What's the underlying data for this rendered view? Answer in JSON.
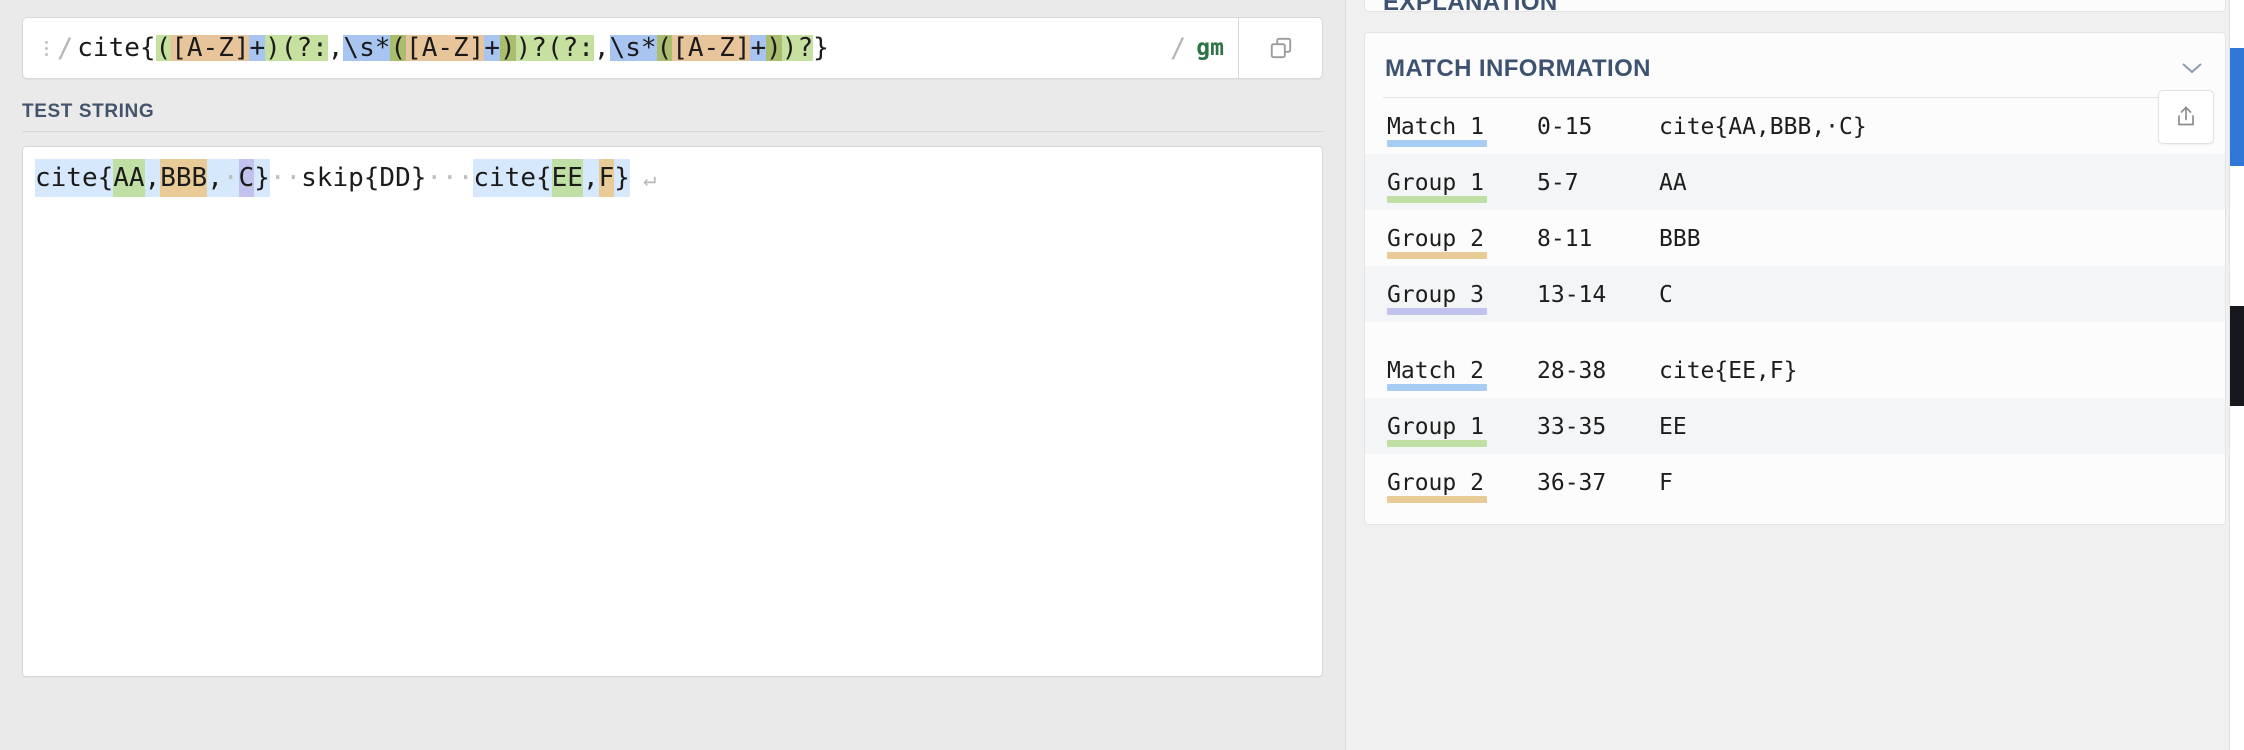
{
  "regex": {
    "delimiter": "/",
    "flags": "gm",
    "pattern_plain": "cite{([A-Z]+)(?:,\\s*([A-Z]+))?(?:,\\s*([A-Z]+))?}",
    "tokens": [
      {
        "t": "cite{",
        "bg": "none"
      },
      {
        "t": "(",
        "bg": "green"
      },
      {
        "t": "[A-Z]",
        "bg": "tan"
      },
      {
        "t": "+",
        "bg": "blue"
      },
      {
        "t": ")",
        "bg": "green"
      },
      {
        "t": "(?:",
        "bg": "green"
      },
      {
        "t": ",",
        "bg": "none"
      },
      {
        "t": "\\s*",
        "bg": "blue"
      },
      {
        "t": "(",
        "bg": "olive"
      },
      {
        "t": "[A-Z]",
        "bg": "tan"
      },
      {
        "t": "+",
        "bg": "blue"
      },
      {
        "t": ")",
        "bg": "olive"
      },
      {
        "t": ")?",
        "bg": "green"
      },
      {
        "t": "(?:",
        "bg": "green"
      },
      {
        "t": ",",
        "bg": "none"
      },
      {
        "t": "\\s*",
        "bg": "blue"
      },
      {
        "t": "(",
        "bg": "olive"
      },
      {
        "t": "[A-Z]",
        "bg": "tan"
      },
      {
        "t": "+",
        "bg": "blue"
      },
      {
        "t": ")",
        "bg": "olive"
      },
      {
        "t": ")?",
        "bg": "green"
      },
      {
        "t": "}",
        "bg": "none"
      }
    ],
    "copy_icon": "copy-icon",
    "drag_handle": "drag-handle-icon"
  },
  "test_string": {
    "heading": "TEST STRING",
    "plain": "cite{AA,BBB, C}  skip{DD}   cite{EE,F}",
    "tokens": [
      {
        "t": "cite{",
        "bg": "match"
      },
      {
        "t": "AA",
        "bg": "g1"
      },
      {
        "t": ",",
        "bg": "match"
      },
      {
        "t": "BBB",
        "bg": "g2"
      },
      {
        "t": ",",
        "bg": "match"
      },
      {
        "t": "·",
        "bg": "match",
        "dot": true
      },
      {
        "t": "C",
        "bg": "g3"
      },
      {
        "t": "}",
        "bg": "match"
      },
      {
        "t": "··",
        "bg": "none",
        "dot": true
      },
      {
        "t": "skip{DD}",
        "bg": "none"
      },
      {
        "t": "···",
        "bg": "none",
        "dot": true
      },
      {
        "t": "cite{",
        "bg": "match"
      },
      {
        "t": "EE",
        "bg": "g1"
      },
      {
        "t": ",",
        "bg": "match"
      },
      {
        "t": "F",
        "bg": "g2"
      },
      {
        "t": "}",
        "bg": "match"
      }
    ],
    "eol_glyph": "↵"
  },
  "explanation_panel": {
    "title": "EXPLANATION",
    "chevron": "chevron-icon"
  },
  "match_information": {
    "title": "MATCH INFORMATION",
    "chevron": "chevron-down-icon",
    "share_icon": "share-icon",
    "rows": [
      {
        "label": "Match 1",
        "range": "0-15",
        "value": "cite{AA,BBB,·C}",
        "bar": "match",
        "alt": false,
        "gap_before": false
      },
      {
        "label": "Group 1",
        "range": "5-7",
        "value": "AA",
        "bar": "g1",
        "alt": true,
        "gap_before": false
      },
      {
        "label": "Group 2",
        "range": "8-11",
        "value": "BBB",
        "bar": "g2",
        "alt": false,
        "gap_before": false
      },
      {
        "label": "Group 3",
        "range": "13-14",
        "value": "C",
        "bar": "g3",
        "alt": true,
        "gap_before": false
      },
      {
        "label": "Match 2",
        "range": "28-38",
        "value": "cite{EE,F}",
        "bar": "match",
        "alt": false,
        "gap_before": true
      },
      {
        "label": "Group 1",
        "range": "33-35",
        "value": "EE",
        "bar": "g1",
        "alt": true,
        "gap_before": false
      },
      {
        "label": "Group 2",
        "range": "36-37",
        "value": "F",
        "bar": "g2",
        "alt": false,
        "gap_before": false
      }
    ]
  },
  "colors": {
    "green": "#c6e0a0",
    "tan": "#e7c49a",
    "blue": "#a8c4f0",
    "olive": "#a9bd6c",
    "match_highlight": "#a8cdf5",
    "match_light": "#d6e8fb",
    "group1": "#bfdfa4",
    "group2": "#e8cb96",
    "group3": "#c2c2ef",
    "flags_color": "#2e7345",
    "heading_color": "#3d5270"
  }
}
